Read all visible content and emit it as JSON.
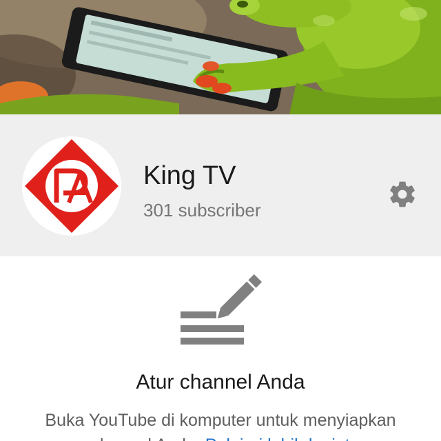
{
  "channel": {
    "name": "King TV",
    "subscribers": "301 subscriber",
    "avatar_icon": "pa-logo",
    "banner_image": "frog-with-phone-photo",
    "settings_icon": "gear-icon"
  },
  "setup": {
    "illustration_icon": "edit-text-icon",
    "title": "Atur channel Anda",
    "description": "Buka YouTube di komputer untuk menyiapkan",
    "description_line2_prefix": "channel Anda.",
    "link_text": "Pelajari lebih lanjut"
  },
  "colors": {
    "header_background": "#efefef",
    "logo_red": "#e0201b",
    "icon_gray": "#808080",
    "link_blue": "#1e73c8"
  }
}
